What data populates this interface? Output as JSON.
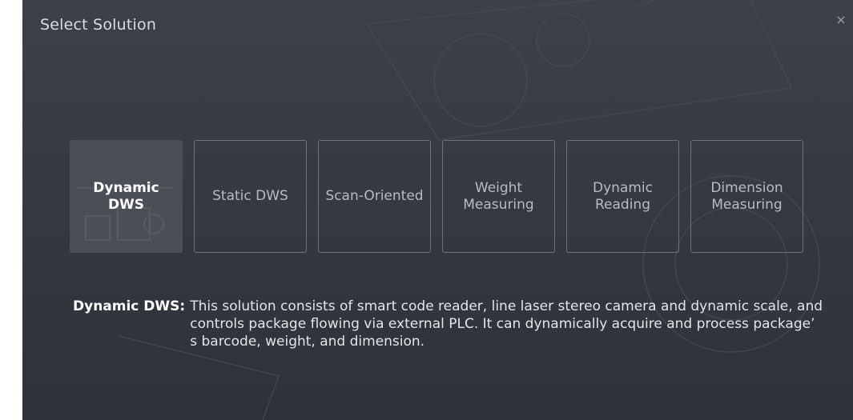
{
  "dialog": {
    "title": "Select Solution",
    "close_label": "×"
  },
  "solutions": [
    {
      "label": "Dynamic\nDWS",
      "selected": true
    },
    {
      "label": "Static DWS",
      "selected": false
    },
    {
      "label": "Scan-Oriented",
      "selected": false
    },
    {
      "label": "Weight\nMeasuring",
      "selected": false
    },
    {
      "label": "Dynamic\nReading",
      "selected": false
    },
    {
      "label": "Dimension\nMeasuring",
      "selected": false
    }
  ],
  "description": {
    "label": "Dynamic DWS:",
    "text": "This solution consists of smart code reader, line laser stereo camera and dynamic scale, and controls package flowing via external PLC. It can dynamically acquire and process package’ s barcode, weight, and dimension."
  },
  "colors": {
    "background": "#353a41",
    "card_border": "#6d7279",
    "selected_card": "#4a4f55"
  }
}
